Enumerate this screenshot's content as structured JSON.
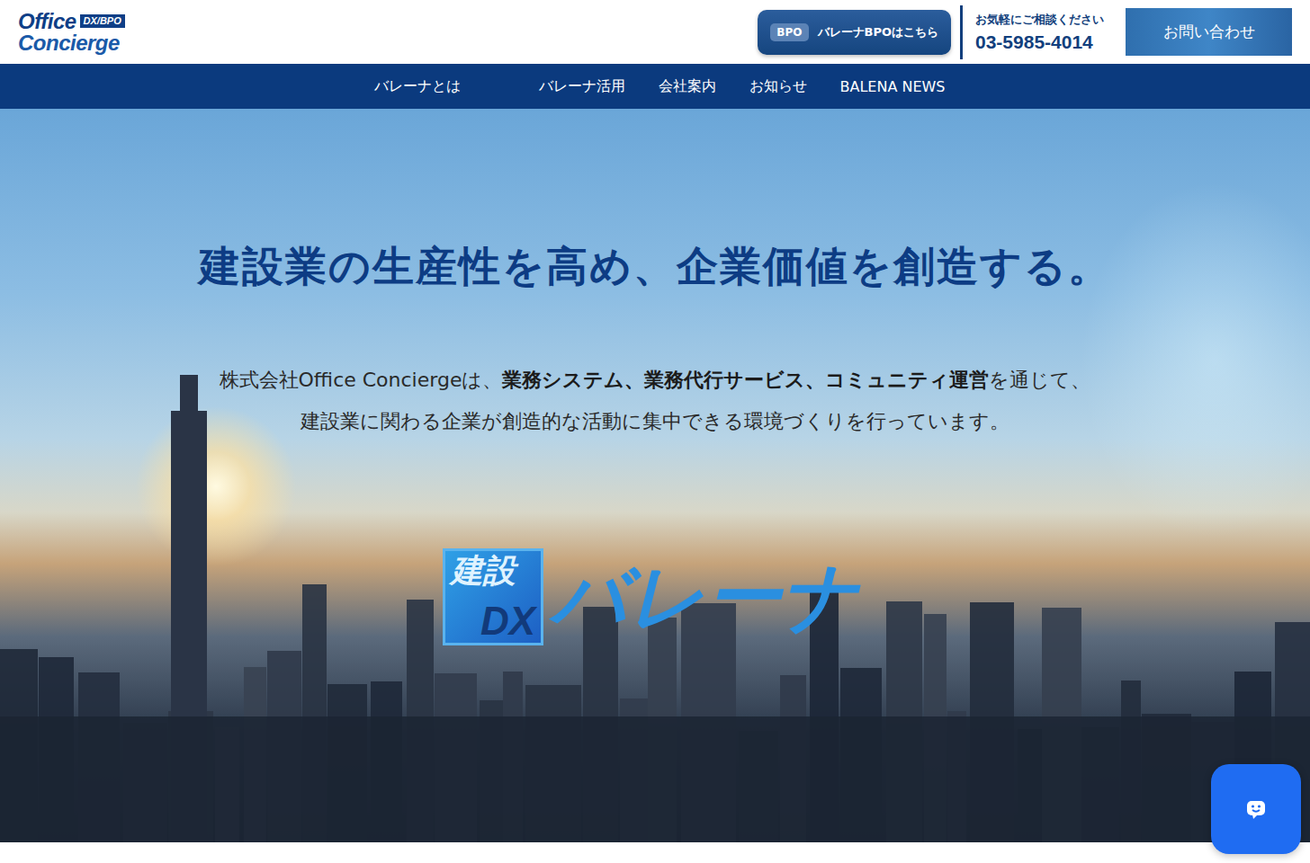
{
  "header": {
    "logo": {
      "line1": "Office",
      "badge": "DX/BPO",
      "line2": "Concierge"
    },
    "bpo_button": {
      "tag": "BPO",
      "label": "バレーナBPOはこちら"
    },
    "contact": {
      "caption": "お気軽にご相談ください",
      "phone": "03-5985-4014"
    },
    "inquiry_button": "お問い合わせ"
  },
  "nav": [
    {
      "label": "バレーナとは"
    },
    {
      "label": "バレーナ活用"
    },
    {
      "label": "会社案内"
    },
    {
      "label": "お知らせ"
    },
    {
      "label": "BALENA NEWS"
    }
  ],
  "hero": {
    "headline": "建設業の生産性を高め、企業価値を創造する。",
    "description": [
      [
        {
          "text": "株式会社Office Conciergeは、",
          "bold": false
        },
        {
          "text": "業務システム、業務代行サービス、コミュニティ運営",
          "bold": true
        },
        {
          "text": "を通じて、",
          "bold": false
        }
      ],
      [
        {
          "text": "建設業に関わる企業が創造的な活動に集中できる環境づくりを行っています。",
          "bold": false
        }
      ]
    ],
    "brand": {
      "box_top": "建設",
      "box_bottom": "DX",
      "name": "バレーナ"
    }
  }
}
